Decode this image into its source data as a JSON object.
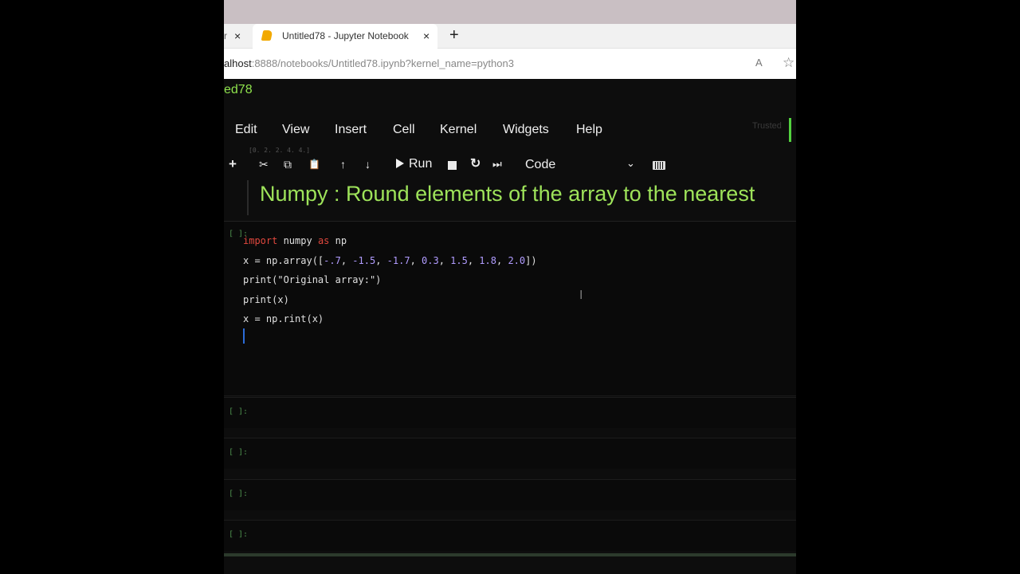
{
  "browser": {
    "prev_tab_fragment": "r",
    "prev_tab_close": "×",
    "tab_title": "Untitled78 - Jupyter Notebook",
    "tab_close": "×",
    "new_tab": "+",
    "url_host": "alhost",
    "url_rest": ":8888/notebooks/Untitled78.ipynb?kernel_name=python3",
    "read_aloud_glyph": "A",
    "favorite_glyph": "☆"
  },
  "notebook": {
    "title": "ed78",
    "menu": [
      "Edit",
      "View",
      "Insert",
      "Cell",
      "Kernel",
      "Widgets",
      "Help"
    ],
    "trusted": "Trusted",
    "ghost_output": "[0. 2. 2. 4. 4.]",
    "toolbar": {
      "add": "+",
      "cut": "✂",
      "copy": "⧉",
      "paste": "📋",
      "move_up": "↑",
      "move_down": "↓",
      "run_label": "Run",
      "restart": "↻",
      "fast_forward": "⏭",
      "cell_type": "Code",
      "chevron": "⌄"
    },
    "markdown_heading": "Numpy : Round elements of the array to the nearest",
    "code_prompt": "[ ]:",
    "code": {
      "l1_kw1": "import",
      "l1_mid": " numpy ",
      "l1_kw2": "as",
      "l1_end": " np",
      "l2_a": "x = np.array([",
      "l2_n1": "-.7",
      "l2_c1": ", ",
      "l2_n2": "-1.5",
      "l2_c2": ", ",
      "l2_n3": "-1.7",
      "l2_c3": ", ",
      "l2_n4": "0.3",
      "l2_c4": ", ",
      "l2_n5": "1.5",
      "l2_c5": ", ",
      "l2_n6": "1.8",
      "l2_c6": ", ",
      "l2_n7": "2.0",
      "l2_end": "])",
      "l3": "print(\"Original array:\")",
      "l4": "print(x)",
      "l5": "x = np.rint(x)"
    },
    "empty_prompt": "[ ]:"
  },
  "colors": {
    "title_green": "#8fe34d",
    "heading_green": "#9ee35a",
    "keyword_red": "#e0473d",
    "number_purple": "#b19cff",
    "kernel_indicator": "#53d23f"
  }
}
